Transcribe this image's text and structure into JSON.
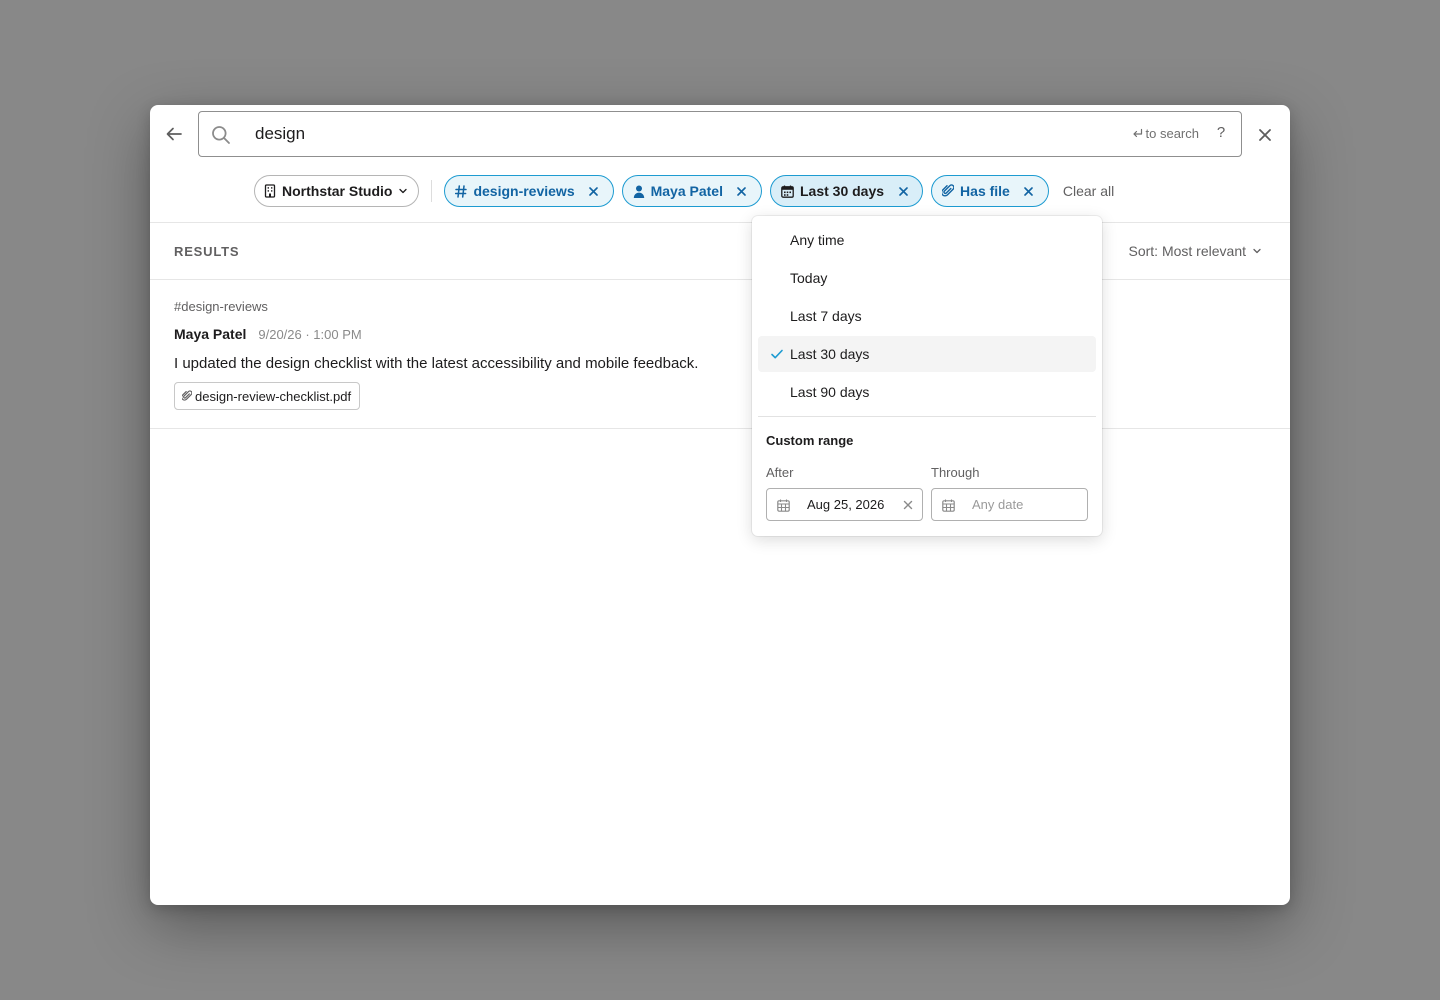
{
  "search": {
    "query": "design",
    "enter_hint": "to search",
    "help_label": "?"
  },
  "filters": {
    "workspace": "Northstar Studio",
    "chips": {
      "channel": "design-reviews",
      "person": "Maya Patel",
      "date": "Last 30 days",
      "file": "Has file"
    },
    "clear_all": "Clear all"
  },
  "results": {
    "header": "RESULTS",
    "sort_label": "Sort: Most relevant",
    "items": [
      {
        "channel": "#design-reviews",
        "author": "Maya Patel",
        "time": "9/20/26 · 1:00 PM",
        "text": "I updated the design checklist with the latest accessibility and mobile feedback.",
        "file": "design-review-checklist.pdf"
      }
    ]
  },
  "date_dropdown": {
    "options": [
      "Any time",
      "Today",
      "Last 7 days",
      "Last 30 days",
      "Last 90 days"
    ],
    "selected": "Last 30 days",
    "custom_range_title": "Custom range",
    "after_label": "After",
    "after_value": "Aug 25, 2026",
    "through_label": "Through",
    "through_placeholder": "Any date"
  },
  "colors": {
    "backdrop": "#888888",
    "chip_border": "#1d9bd1",
    "chip_bg": "#e8f5fa",
    "chip_text": "#1264a3",
    "check": "#1d9bd1"
  },
  "icons": [
    "back-arrow-icon",
    "search-icon",
    "enter-key-icon",
    "close-icon",
    "building-icon",
    "chevron-down-icon",
    "hash-icon",
    "person-icon",
    "calendar-icon",
    "paperclip-icon",
    "checkmark-icon"
  ]
}
